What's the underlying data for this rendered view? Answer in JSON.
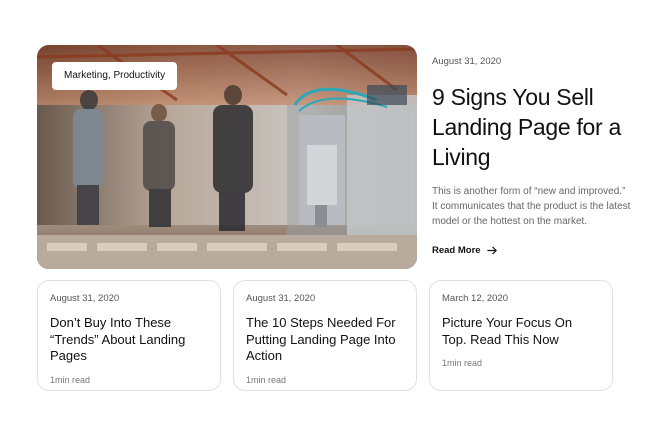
{
  "featured": {
    "tag": "Marketing, Productivity",
    "date": "August 31, 2020",
    "title": "9 Signs You Sell Landing Page for a Living",
    "excerpt": "This is another form of “new and improved.” It communicates that the product is the latest model or the hottest on the market.",
    "read_more": "Read More",
    "arrow_icon": "arrow-right-icon"
  },
  "cards": [
    {
      "date": "August 31, 2020",
      "title": "Don’t Buy Into These “Trends” About Landing Pages",
      "read_time": "1min read"
    },
    {
      "date": "August 31, 2020",
      "title": "The 10 Steps Needed For Putting Landing Page Into Action",
      "read_time": "1min read"
    },
    {
      "date": "March 12, 2020",
      "title": "Picture Your Focus On Top. Read This Now",
      "read_time": "1min read"
    }
  ],
  "colors": {
    "text": "#111111",
    "muted": "#666666",
    "border": "#e0e0e0"
  }
}
